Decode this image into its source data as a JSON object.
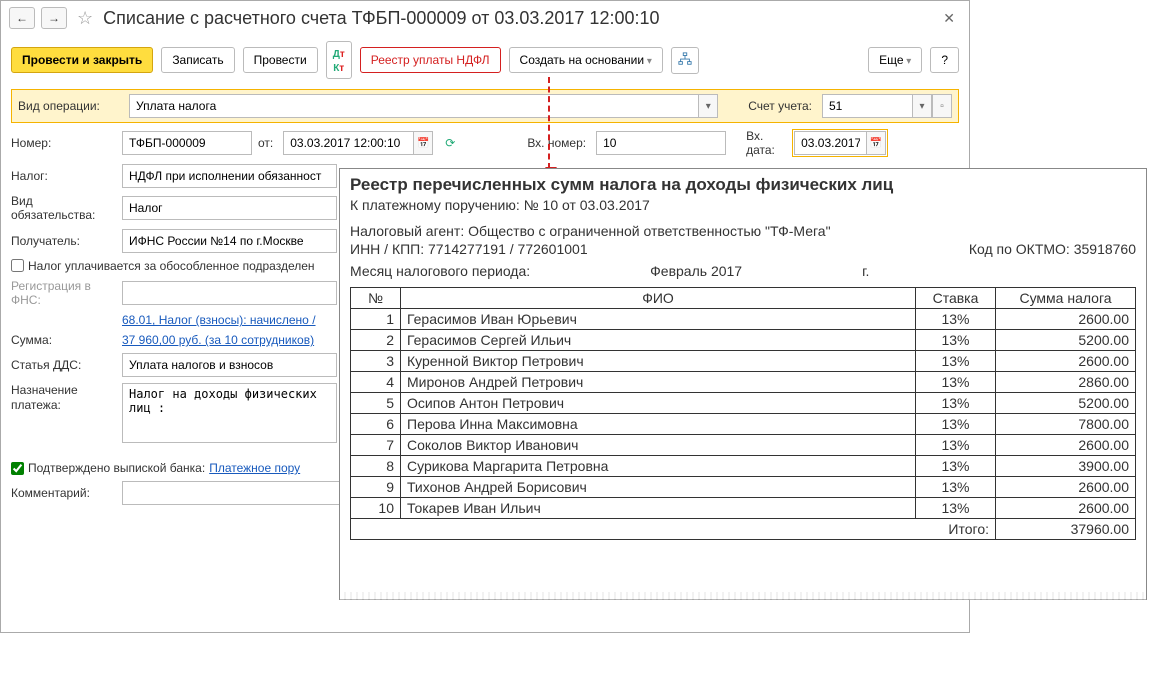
{
  "title": "Списание с расчетного счета ТФБП-000009 от 03.03.2017 12:00:10",
  "toolbar": {
    "post_close": "Провести и закрыть",
    "save": "Записать",
    "post": "Провести",
    "ndfl_registry": "Реестр уплаты НДФЛ",
    "create_based": "Создать на основании",
    "more": "Еще",
    "help": "?"
  },
  "fields": {
    "op_type_label": "Вид операции:",
    "op_type": "Уплата налога",
    "account_label": "Счет учета:",
    "account": "51",
    "number_label": "Номер:",
    "number": "ТФБП-000009",
    "from_label": "от:",
    "date": "03.03.2017 12:00:10",
    "in_number_label": "Вх. номер:",
    "in_number": "10",
    "in_date_label": "Вх. дата:",
    "in_date": "03.03.2017",
    "tax_label": "Налог:",
    "tax": "НДФЛ при исполнении обязанност",
    "obligation_type_label": "Вид обязательства:",
    "obligation_type": "Налог",
    "recipient_label": "Получатель:",
    "recipient": "ИФНС России №14 по г.Москве",
    "separate_unit_check": "Налог уплачивается за обособленное подразделен",
    "fns_reg_label": "Регистрация в ФНС:",
    "tax_link": "68.01, Налог (взносы): начислено /",
    "sum_label": "Сумма:",
    "sum_link": "37 960,00 руб. (за 10 сотрудников)",
    "dds_label": "Статья ДДС:",
    "dds": "Уплата налогов и взносов",
    "purpose_label": "Назначение платежа:",
    "purpose": "Налог на доходы физических лиц :",
    "confirmed_label": "Подтверждено выпиской банка:",
    "payment_order_link": "Платежное пору",
    "comment_label": "Комментарий:"
  },
  "report": {
    "title": "Реестр перечисленных сумм налога на доходы физических лиц",
    "subtitle": "К платежному поручению: № 10 от 03.03.2017",
    "agent": "Налоговый агент: Общество с ограниченной ответственностью \"ТФ-Мега\"",
    "inn_kpp": "ИНН / КПП: 7714277191 / 772601001",
    "oktmo": "Код по ОКТМО: 35918760",
    "period_label": "Месяц налогового периода:",
    "period_value": "Февраль 2017",
    "period_suffix": "г.",
    "headers": {
      "num": "№",
      "fio": "ФИО",
      "rate": "Ставка",
      "amount": "Сумма налога"
    },
    "rows": [
      {
        "n": "1",
        "fio": "Герасимов Иван Юрьевич",
        "rate": "13%",
        "amount": "2600.00"
      },
      {
        "n": "2",
        "fio": "Герасимов Сергей Ильич",
        "rate": "13%",
        "amount": "5200.00"
      },
      {
        "n": "3",
        "fio": "Куренной Виктор Петрович",
        "rate": "13%",
        "amount": "2600.00"
      },
      {
        "n": "4",
        "fio": "Миронов Андрей Петрович",
        "rate": "13%",
        "amount": "2860.00"
      },
      {
        "n": "5",
        "fio": "Осипов Антон Петрович",
        "rate": "13%",
        "amount": "5200.00"
      },
      {
        "n": "6",
        "fio": "Перова Инна Максимовна",
        "rate": "13%",
        "amount": "7800.00"
      },
      {
        "n": "7",
        "fio": "Соколов Виктор Иванович",
        "rate": "13%",
        "amount": "2600.00"
      },
      {
        "n": "8",
        "fio": "Сурикова Маргарита Петровна",
        "rate": "13%",
        "amount": "3900.00"
      },
      {
        "n": "9",
        "fio": "Тихонов Андрей Борисович",
        "rate": "13%",
        "amount": "2600.00"
      },
      {
        "n": "10",
        "fio": "Токарев Иван Ильич",
        "rate": "13%",
        "amount": "2600.00"
      }
    ],
    "total_label": "Итого:",
    "total": "37960.00"
  }
}
